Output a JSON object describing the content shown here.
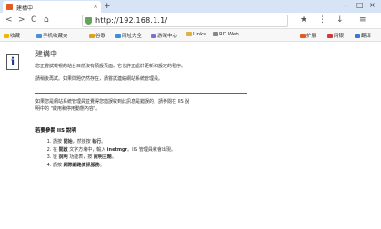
{
  "browser": {
    "tab_title": "建構中",
    "tab_close": "×",
    "new_tab": "+",
    "window_controls": [
      "–",
      "□",
      "×"
    ],
    "url": "http://192.168.1.1/",
    "nav_buttons": [
      "<",
      ">",
      "C",
      "⌂"
    ],
    "right_tools": [
      "★",
      "⋮",
      "↓",
      "≡"
    ],
    "favorites": [
      {
        "label": "收藏",
        "color": "#f4b400"
      },
      {
        "label": "手机收藏夹",
        "color": "#4a90d9"
      },
      {
        "label": "谷歌",
        "color": "#e0a020"
      },
      {
        "label": "网址大全",
        "color": "#3b8ede"
      },
      {
        "label": "游戏中心",
        "color": "#7b6fd0"
      },
      {
        "label": "Links",
        "color": "#e0b040"
      },
      {
        "label": "RD Web",
        "color": "#888888"
      }
    ],
    "fav_right": [
      {
        "label": "扩展",
        "color": "#e35b1e"
      },
      {
        "label": "网银",
        "color": "#d23a3a"
      },
      {
        "label": "翻译",
        "color": "#3a78d2"
      }
    ]
  },
  "page": {
    "title": "建構中",
    "para1": "您正嘗試檢視的站台目前沒有預設頁面。它也許正處於更新和設定的程序。",
    "para2": "請稍後再試。如果問題仍然存在，請嘗試連絡網站系統管理員。",
    "para3a": "如果您是網站系統管理員並覺得您錯誤收到此訊息是錯誤的，請參閱在 IIS 說",
    "para3b": "明中的 \"啟用和停用動態內容\"。",
    "help_heading": "若要參閱 IIS 說明",
    "steps": [
      {
        "pre": "請按 ",
        "b1": "開始",
        "mid": "，然後按 ",
        "b2": "執行",
        "post": "。"
      },
      {
        "pre": "在 ",
        "b1": "開啟",
        "mid": " 文字方塊中，輸入 ",
        "b2": "inetmgr",
        "post": "。IIS 管理員就會出現。"
      },
      {
        "pre": "從 ",
        "b1": "說明",
        "mid": " 功能表，按 ",
        "b2": "說明主題",
        "post": "。"
      },
      {
        "pre": "請按 ",
        "b1": "網際網路資訊服務",
        "mid": "。",
        "b2": "",
        "post": ""
      }
    ]
  }
}
